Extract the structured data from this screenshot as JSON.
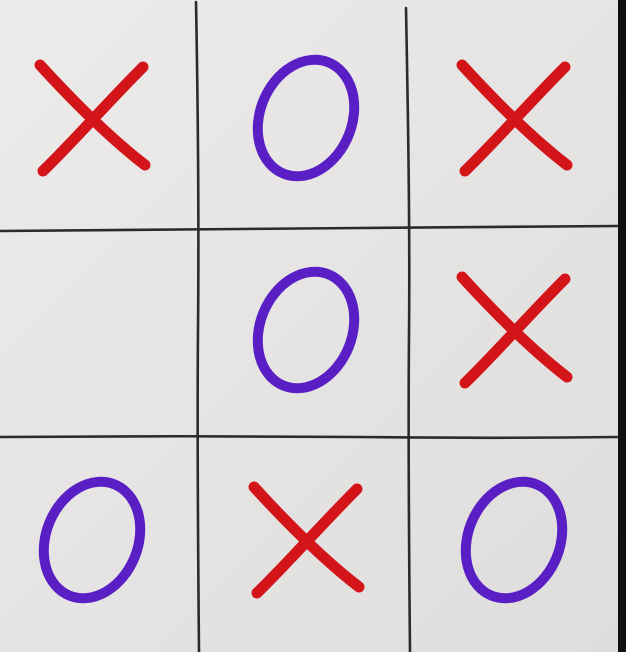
{
  "board": {
    "rows": [
      [
        "X",
        "O",
        "X"
      ],
      [
        "",
        "O",
        "X"
      ],
      [
        "O",
        "X",
        "O"
      ]
    ]
  },
  "colors": {
    "paper": "#e7e6e5",
    "grid": "#2b2b2b",
    "x_mark": "#d3151a",
    "o_mark": "#5a1fc4"
  },
  "icons": {
    "x_mark": "cross-icon",
    "o_mark": "circle-icon"
  }
}
